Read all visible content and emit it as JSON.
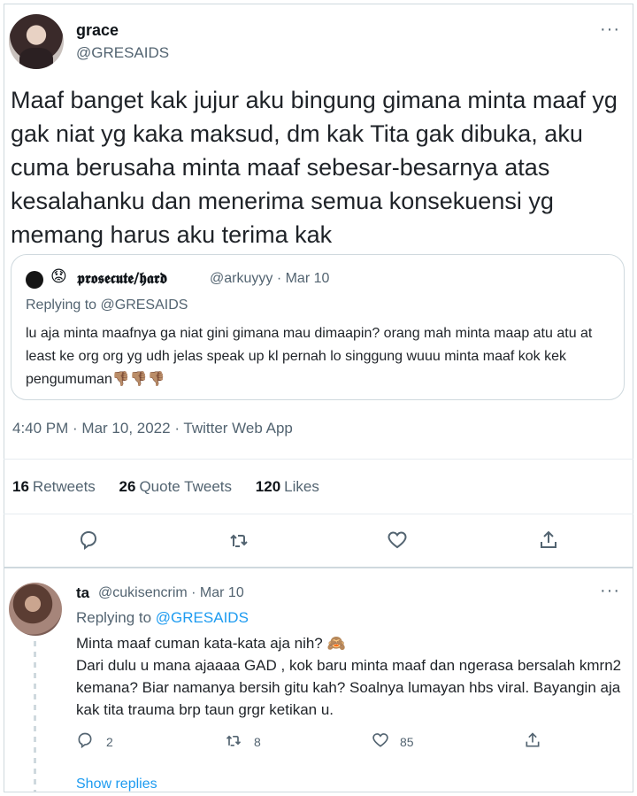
{
  "tweet": {
    "name": "grace",
    "handle": "@GRESAIDS",
    "more": "···",
    "text": "Maaf banget kak jujur aku bingung gimana minta maaf yg gak niat yg kaka maksud, dm kak Tita gak dibuka, aku cuma berusaha minta maaf sebesar-besarnya atas kesalahanku dan menerima semua konsekuensi yg memang harus aku terima kak",
    "timestamp": "4:40 PM · Mar 10, 2022 · Twitter Web App",
    "stats": {
      "retweets_count": "16",
      "retweets_label": "Retweets",
      "quotes_count": "26",
      "quotes_label": "Quote Tweets",
      "likes_count": "120",
      "likes_label": "Likes"
    }
  },
  "quoted": {
    "emoji": "😟",
    "name": "𝖕𝖗𝖔𝖘𝖊𝖈𝖚𝖙𝖊/𝖍𝖆𝖗𝖉",
    "meta": "@arkuyyy · Mar 10",
    "replying_prefix": "Replying to",
    "replying_handle": "@GRESAIDS",
    "text": "lu aja minta maafnya ga niat gini gimana mau dimaapin? orang mah minta maap atu atu at least ke org org yg udh jelas speak up kl pernah lo singgung wuuu minta maaf kok kek pengumuman👎🏽👎🏽👎🏽"
  },
  "reply": {
    "name": "ta",
    "meta": "@cukisencrim · Mar 10",
    "more": "···",
    "replying_prefix": "Replying to",
    "replying_handle": "@GRESAIDS",
    "text": "Minta maaf cuman kata-kata aja nih? 🙈\nDari dulu u mana ajaaaa GAD , kok baru minta maaf dan ngerasa bersalah kmrn2 kemana? Biar namanya bersih gitu kah? Soalnya lumayan hbs viral. Bayangin aja kak tita trauma brp taun grgr ketikan u.",
    "reply_count": "2",
    "retweet_count": "8",
    "like_count": "85",
    "show_replies": "Show replies"
  },
  "icons": {
    "reply": "reply-icon",
    "retweet": "retweet-icon",
    "like": "heart-icon",
    "share": "share-icon"
  },
  "colors": {
    "link": "#1d9bf0",
    "secondary_text": "#536471",
    "border": "#cfd9de"
  }
}
